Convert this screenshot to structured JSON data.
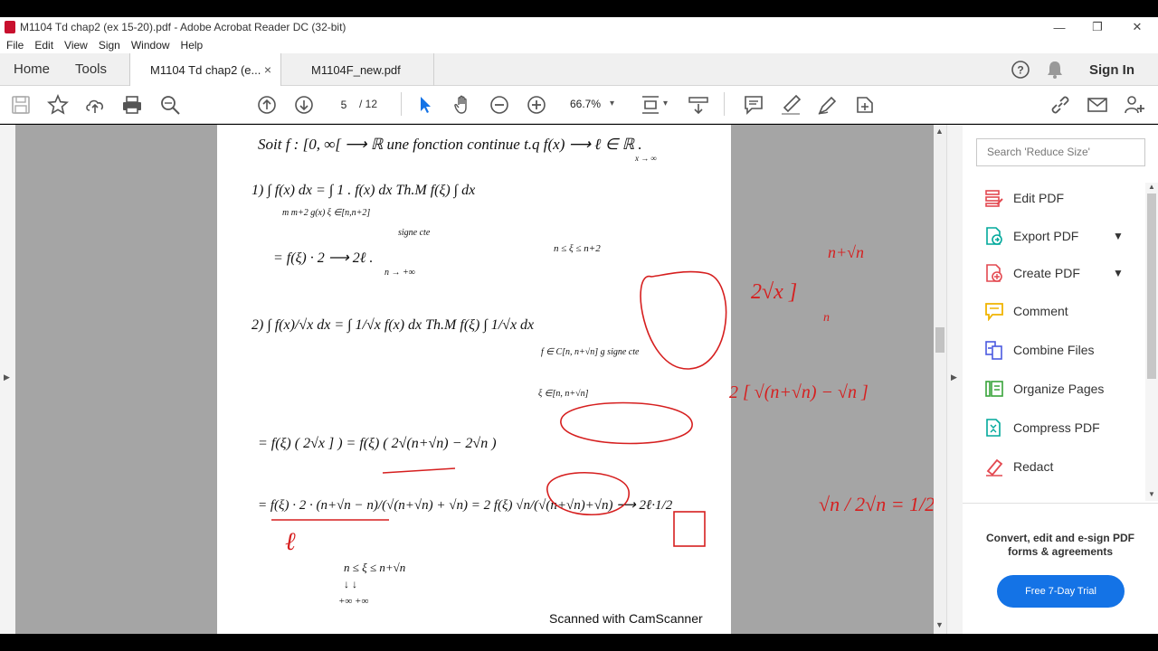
{
  "window": {
    "title": "M1104 Td chap2 (ex 15-20).pdf - Adobe Acrobat Reader DC (32-bit)",
    "controls": {
      "minimize": "—",
      "restore": "❐",
      "close": "✕"
    }
  },
  "menu": [
    "File",
    "Edit",
    "View",
    "Sign",
    "Window",
    "Help"
  ],
  "tabs": {
    "home": "Home",
    "tools": "Tools",
    "documents": [
      {
        "label": "M1104 Td chap2 (e...",
        "close": "×",
        "active": true
      },
      {
        "label": "M1104F_new.pdf",
        "active": false
      }
    ],
    "sign_in": "Sign In"
  },
  "toolbar": {
    "page_current": "5",
    "page_total": "/ 12",
    "zoom": "66.7%"
  },
  "document": {
    "footer": "Scanned with CamScanner",
    "lines": {
      "l1": "Soit f : [0, ∞[ ⟶ ℝ une fonction continue t.q f(x) ⟶ ℓ ∈ ℝ .",
      "l1sub": "x → ∞",
      "l2": "1)  ∫ f(x) dx = ∫ 1 . f(x) dx  Th.M  f(ξ) ∫ dx",
      "l2b": "m   m+2          g(x)      ξ ∈[n,n+2]",
      "l2c": "signe cte",
      "l3": "= f(ξ) · 2  ⟶  2ℓ .",
      "l3b": "n → +∞",
      "l3c": "n ≤ ξ ≤ n+2",
      "l4": "2)  ∫ f(x)/√x dx = ∫ 1/√x f(x) dx   Th.M   f(ξ) ∫ 1/√x dx",
      "l4b": "f ∈ C[n, n+√n]   g signe cte",
      "l4c": "ξ ∈[n, n+√n]",
      "l5": "= f(ξ) ( 2√x ]  ) = f(ξ) ( 2√(n+√n) − 2√n )",
      "l6": "= f(ξ) · 2 · (n+√n − n)/(√(n+√n) + √n) = 2 f(ξ) √n/(√(n+√n)+√n) ⟶ 2ℓ·1/2",
      "l6b": "ℓ",
      "l7": "n ≤ ξ ≤ n+√n",
      "l7b": "↓          ↓",
      "l7c": "+∞        +∞"
    },
    "annotations": {
      "a1": "2√x ]",
      "a1b": "n+√n",
      "a1c": "n",
      "a2": "2 [ √(n+√n) − √n ]",
      "a3": "√n / 2√n = 1/2"
    }
  },
  "panel": {
    "search_placeholder": "Search 'Reduce Size'",
    "tools": [
      {
        "label": "Edit PDF",
        "icon": "edit-pdf-icon",
        "color": "#e34850",
        "chevron": false
      },
      {
        "label": "Export PDF",
        "icon": "export-pdf-icon",
        "color": "#00a89b",
        "chevron": true
      },
      {
        "label": "Create PDF",
        "icon": "create-pdf-icon",
        "color": "#e34850",
        "chevron": true
      },
      {
        "label": "Comment",
        "icon": "comment-icon",
        "color": "#f0b400",
        "chevron": false
      },
      {
        "label": "Combine Files",
        "icon": "combine-files-icon",
        "color": "#4b5ae0",
        "chevron": false
      },
      {
        "label": "Organize Pages",
        "icon": "organize-pages-icon",
        "color": "#38a33a",
        "chevron": false
      },
      {
        "label": "Compress PDF",
        "icon": "compress-pdf-icon",
        "color": "#00a89b",
        "chevron": false
      },
      {
        "label": "Redact",
        "icon": "redact-icon",
        "color": "#e34850",
        "chevron": false
      }
    ],
    "promo": "Convert, edit and e-sign PDF forms & agreements",
    "trial_button": "Free 7-Day Trial"
  },
  "colors": {
    "accent": "#1473e6",
    "ink": "#111111",
    "pen": "#d61f1f",
    "viewer_bg": "#a5a5a5"
  }
}
